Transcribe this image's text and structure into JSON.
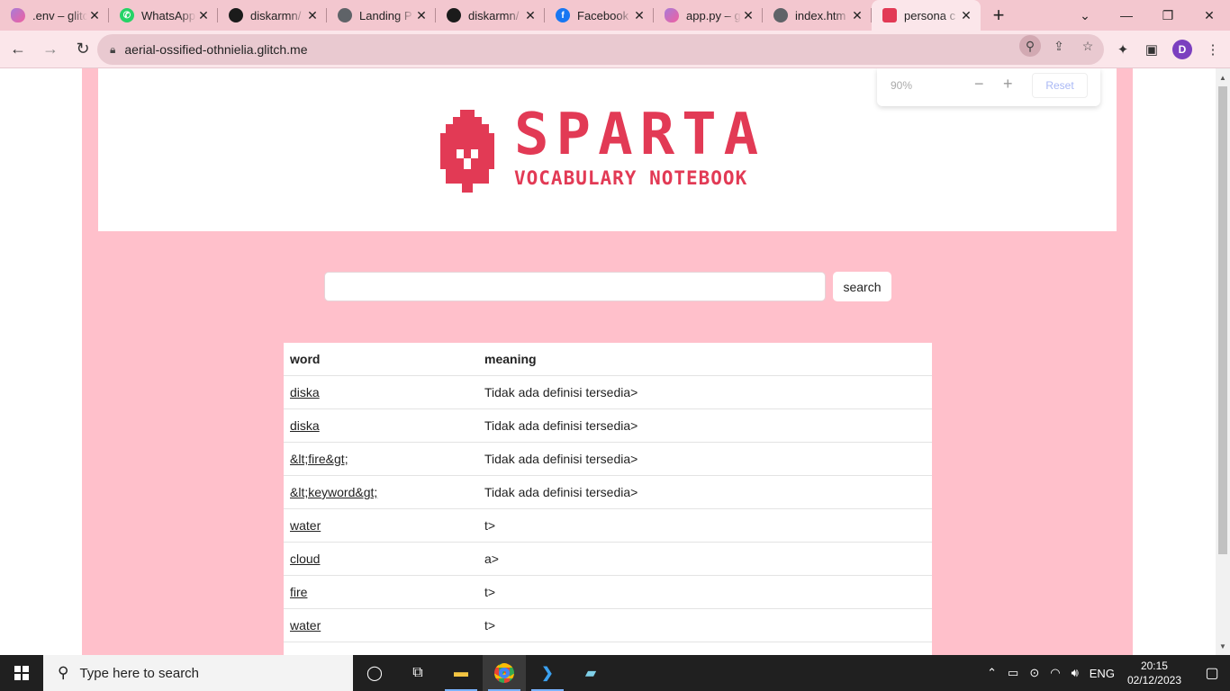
{
  "browser": {
    "tabs": [
      {
        "title": ".env – glitch",
        "favicon": "glitch-icon",
        "active": false
      },
      {
        "title": "WhatsApp",
        "favicon": "whatsapp-icon",
        "active": false
      },
      {
        "title": "diskarmn/",
        "favicon": "github-icon",
        "active": false
      },
      {
        "title": "Landing P",
        "favicon": "globe-icon",
        "active": false
      },
      {
        "title": "diskarmn/",
        "favicon": "github-icon",
        "active": false
      },
      {
        "title": "Facebook",
        "favicon": "facebook-icon",
        "active": false
      },
      {
        "title": "app.py – glitch",
        "favicon": "glitch-icon",
        "active": false
      },
      {
        "title": "index.htm",
        "favicon": "globe-icon",
        "active": false
      },
      {
        "title": "persona c",
        "favicon": "sparta-icon",
        "active": true
      }
    ],
    "new_tab": "+",
    "url": "aerial-ossified-othnielia.glitch.me",
    "profile_initial": "D",
    "zoom_popup": {
      "percent": "90%",
      "minus": "−",
      "plus": "+",
      "reset": "Reset"
    }
  },
  "page": {
    "logo_title": "SPARTA",
    "logo_subtitle": "VOCABULARY NOTEBOOK",
    "search": {
      "placeholder": "",
      "button": "search"
    },
    "table": {
      "headers": [
        "word",
        "meaning"
      ],
      "rows": [
        {
          "word": "diska",
          "meaning": "Tidak ada definisi tersedia>"
        },
        {
          "word": "diska",
          "meaning": "Tidak ada definisi tersedia>"
        },
        {
          "word": "&lt;fire&gt;",
          "meaning": "Tidak ada definisi tersedia>"
        },
        {
          "word": "&lt;keyword&gt;",
          "meaning": "Tidak ada definisi tersedia>"
        },
        {
          "word": "water",
          "meaning": "t>"
        },
        {
          "word": "cloud",
          "meaning": "a>"
        },
        {
          "word": "fire",
          "meaning": "t>"
        },
        {
          "word": "water",
          "meaning": "t>"
        }
      ]
    }
  },
  "taskbar": {
    "search_placeholder": "Type here to search",
    "language": "ENG",
    "time": "20:15",
    "date": "02/12/2023"
  },
  "colors": {
    "brand": "#e23a55",
    "page_bg": "#ffc0cb",
    "tab_strip": "#f3c7cf"
  }
}
